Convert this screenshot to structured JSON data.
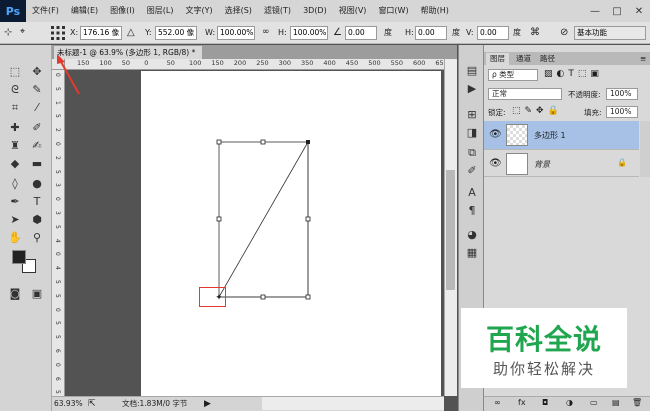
{
  "app": {
    "logo": "Ps"
  },
  "menu": [
    "文件(F)",
    "编辑(E)",
    "图像(I)",
    "图层(L)",
    "文字(Y)",
    "选择(S)",
    "滤镜(T)",
    "3D(D)",
    "视图(V)",
    "窗口(W)",
    "帮助(H)"
  ],
  "window_controls": [
    "—",
    "□",
    "✕"
  ],
  "options": {
    "x_label": "X:",
    "x_value": "176.16 像",
    "y_label": "Y:",
    "y_value": "552.00 像",
    "w_label": "W:",
    "w_value": "100.00%",
    "h_label": "H:",
    "h_value": "100.00%",
    "angle_value": "0.00",
    "angle_unit": "度",
    "hskew_label": "H:",
    "hskew_value": "0.00",
    "hskew_unit": "度",
    "vskew_label": "V:",
    "vskew_value": "0.00",
    "vskew_unit": "度",
    "workspace": "基本功能"
  },
  "document": {
    "tab": "未标题-1 @ 63.9% (多边形 1, RGB/8) *",
    "zoom": "63.93%",
    "doc_info": "文档:1.83M/0 字节"
  },
  "ruler": {
    "top": [
      "150",
      "100",
      "50",
      "0",
      "50",
      "100",
      "150",
      "200",
      "250",
      "300",
      "350",
      "400",
      "450",
      "500",
      "550",
      "600",
      "650"
    ],
    "left": [
      "0",
      "5",
      "1",
      "5",
      "2",
      "0",
      "2",
      "5",
      "3",
      "0",
      "3",
      "5",
      "4",
      "0",
      "4",
      "5",
      "5",
      "0",
      "5",
      "5",
      "6",
      "0",
      "6",
      "5"
    ]
  },
  "layers": {
    "tabs": [
      "图层",
      "通道",
      "路径"
    ],
    "kind_label": "ρ 类型",
    "blend_mode": "正常",
    "opacity_label": "不透明度:",
    "opacity_value": "100%",
    "lock_label": "锁定:",
    "fill_label": "填充:",
    "fill_value": "100%",
    "items": [
      {
        "name": "多边形 1",
        "selected": true
      },
      {
        "name": "背景",
        "locked": true
      }
    ],
    "bottom_icons": [
      "∞",
      "fx",
      "◘",
      "◑",
      "▭",
      "▤",
      "🗑"
    ]
  },
  "watermark": {
    "title": "百科全说",
    "subtitle": "助你轻松解决"
  },
  "colors": {
    "selected_layer": "#a7c1e6",
    "annotation": "#e23b2e",
    "watermark_green": "#21a650"
  }
}
